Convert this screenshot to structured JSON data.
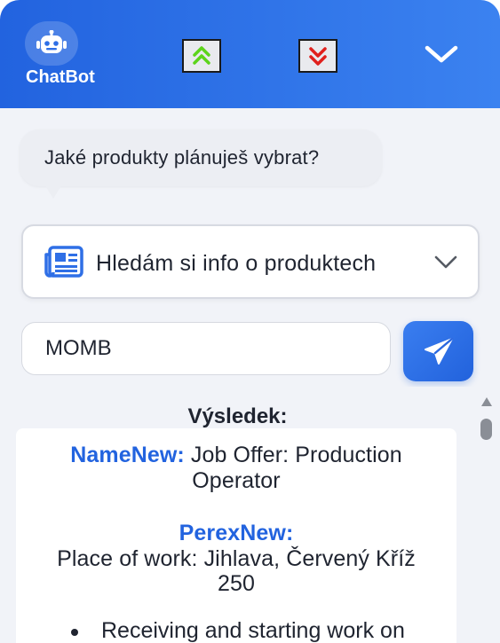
{
  "header": {
    "brand": "ChatBot",
    "icons": {
      "avatar": "robot-icon",
      "scroll_up": "double-chevron-up-icon",
      "scroll_down": "double-chevron-down-icon",
      "collapse": "chevron-down-icon"
    },
    "colors": {
      "gradient_start": "#2263df",
      "gradient_end": "#3b82f0",
      "scroll_up_accent": "#5cd41a",
      "scroll_down_accent": "#e0201d"
    }
  },
  "chat": {
    "bot_message": "Jaké produkty plánuješ vybrat?"
  },
  "select": {
    "icon": "newspaper-icon",
    "selected_label": "Hledám si info o produktech"
  },
  "input": {
    "value": "MOMB",
    "send_icon": "paper-plane-icon"
  },
  "result": {
    "title": "Výsledek:",
    "name_key": "NameNew:",
    "name_value_line1": "Job Offer: Production",
    "name_value_line2": "Operator",
    "perex_key": "PerexNew:",
    "perex_value_line1": "Place of work: Jihlava, Červený Kříž",
    "perex_value_line2": "250",
    "bullet_1": "Receiving and starting work on"
  },
  "colors": {
    "accent": "#2263df",
    "text": "#1f2430",
    "panel_bg": "#f1f3f8"
  }
}
